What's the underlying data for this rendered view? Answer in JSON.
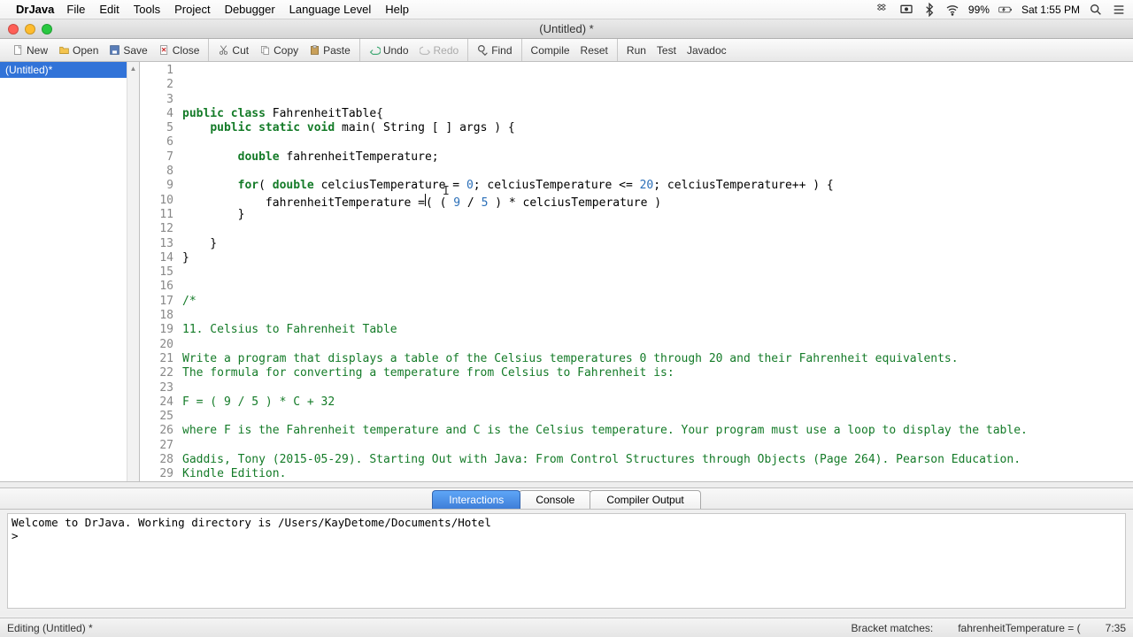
{
  "menubar": {
    "app": "DrJava",
    "items": [
      "File",
      "Edit",
      "Tools",
      "Project",
      "Debugger",
      "Language Level",
      "Help"
    ],
    "battery": "99%",
    "clock": "Sat 1:55 PM"
  },
  "window": {
    "title": "(Untitled) *"
  },
  "toolbar": {
    "new": "New",
    "open": "Open",
    "save": "Save",
    "close": "Close",
    "cut": "Cut",
    "copy": "Copy",
    "paste": "Paste",
    "undo": "Undo",
    "redo": "Redo",
    "find": "Find",
    "compile": "Compile",
    "reset": "Reset",
    "run": "Run",
    "test": "Test",
    "javadoc": "Javadoc"
  },
  "sidebar": {
    "file": "(Untitled)*"
  },
  "code": {
    "lines": [
      {
        "n": 1,
        "seg": [
          {
            "t": "public ",
            "c": "kw"
          },
          {
            "t": "class ",
            "c": "kw"
          },
          {
            "t": "FahrenheitTable{",
            "c": ""
          }
        ]
      },
      {
        "n": 2,
        "seg": [
          {
            "t": "    ",
            "c": ""
          },
          {
            "t": "public static ",
            "c": "kw"
          },
          {
            "t": "void ",
            "c": "type"
          },
          {
            "t": "main( String [ ] args ) {",
            "c": ""
          }
        ]
      },
      {
        "n": 3,
        "seg": [
          {
            "t": "",
            "c": ""
          }
        ]
      },
      {
        "n": 4,
        "seg": [
          {
            "t": "        ",
            "c": ""
          },
          {
            "t": "double ",
            "c": "type"
          },
          {
            "t": "fahrenheitTemperature;",
            "c": ""
          }
        ]
      },
      {
        "n": 5,
        "seg": [
          {
            "t": "",
            "c": ""
          }
        ]
      },
      {
        "n": 6,
        "seg": [
          {
            "t": "        ",
            "c": ""
          },
          {
            "t": "for",
            "c": "kw"
          },
          {
            "t": "( ",
            "c": ""
          },
          {
            "t": "double ",
            "c": "type"
          },
          {
            "t": "celciusTemperature = ",
            "c": ""
          },
          {
            "t": "0",
            "c": "num"
          },
          {
            "t": "; celciusTemperature <= ",
            "c": ""
          },
          {
            "t": "20",
            "c": "num"
          },
          {
            "t": "; celciusTemperature++ ) {",
            "c": ""
          }
        ]
      },
      {
        "n": 7,
        "seg": [
          {
            "t": "            fahrenheitTemperature =",
            "c": ""
          },
          {
            "t": "|",
            "c": "cursor"
          },
          {
            "t": "( ( ",
            "c": ""
          },
          {
            "t": "9",
            "c": "num"
          },
          {
            "t": " / ",
            "c": ""
          },
          {
            "t": "5",
            "c": "num"
          },
          {
            "t": " ) * celciusTemperature )",
            "c": ""
          }
        ]
      },
      {
        "n": 8,
        "seg": [
          {
            "t": "        }",
            "c": ""
          }
        ]
      },
      {
        "n": 9,
        "seg": [
          {
            "t": "",
            "c": ""
          }
        ]
      },
      {
        "n": 10,
        "seg": [
          {
            "t": "    }",
            "c": ""
          }
        ]
      },
      {
        "n": 11,
        "seg": [
          {
            "t": "}",
            "c": ""
          }
        ]
      },
      {
        "n": 12,
        "seg": [
          {
            "t": "",
            "c": ""
          }
        ]
      },
      {
        "n": 13,
        "seg": [
          {
            "t": "",
            "c": ""
          }
        ]
      },
      {
        "n": 14,
        "seg": [
          {
            "t": "/*",
            "c": "com"
          }
        ]
      },
      {
        "n": 15,
        "seg": [
          {
            "t": "",
            "c": ""
          }
        ]
      },
      {
        "n": 16,
        "seg": [
          {
            "t": "11. Celsius to Fahrenheit Table",
            "c": "com"
          }
        ]
      },
      {
        "n": 17,
        "seg": [
          {
            "t": "",
            "c": ""
          }
        ]
      },
      {
        "n": 18,
        "seg": [
          {
            "t": "Write a program that displays a table of the Celsius temperatures 0 through 20 and their Fahrenheit equivalents.",
            "c": "com"
          }
        ]
      },
      {
        "n": 19,
        "seg": [
          {
            "t": "The formula for converting a temperature from Celsius to Fahrenheit is:",
            "c": "com"
          }
        ]
      },
      {
        "n": 20,
        "seg": [
          {
            "t": "",
            "c": ""
          }
        ]
      },
      {
        "n": 21,
        "seg": [
          {
            "t": "F = ( 9 / 5 ) * C + 32",
            "c": "com"
          }
        ]
      },
      {
        "n": 22,
        "seg": [
          {
            "t": "",
            "c": ""
          }
        ]
      },
      {
        "n": 23,
        "seg": [
          {
            "t": "where F is the Fahrenheit temperature and C is the Celsius temperature. Your program must use a loop to display the table.",
            "c": "com"
          }
        ]
      },
      {
        "n": 24,
        "seg": [
          {
            "t": "",
            "c": ""
          }
        ]
      },
      {
        "n": 25,
        "seg": [
          {
            "t": "Gaddis, Tony (2015-05-29). Starting Out with Java: From Control Structures through Objects (Page 264). Pearson Education.",
            "c": "com"
          }
        ]
      },
      {
        "n": 26,
        "seg": [
          {
            "t": "Kindle Edition.",
            "c": "com"
          }
        ]
      },
      {
        "n": 27,
        "seg": [
          {
            "t": "",
            "c": ""
          }
        ]
      },
      {
        "n": 28,
        "seg": [
          {
            "t": "*/",
            "c": "com"
          }
        ]
      },
      {
        "n": 29,
        "seg": [
          {
            "t": "",
            "c": ""
          }
        ]
      }
    ],
    "caret_extra": "I"
  },
  "tabs": {
    "interactions": "Interactions",
    "console": "Console",
    "compiler": "Compiler Output"
  },
  "interactions": {
    "welcome": "Welcome to DrJava.  Working directory is /Users/KayDetome/Documents/Hotel",
    "prompt": ">"
  },
  "status": {
    "left": "Editing (Untitled) *",
    "bracket": "Bracket matches:",
    "bracket_val": "fahrenheitTemperature = (",
    "pos": "7:35"
  }
}
